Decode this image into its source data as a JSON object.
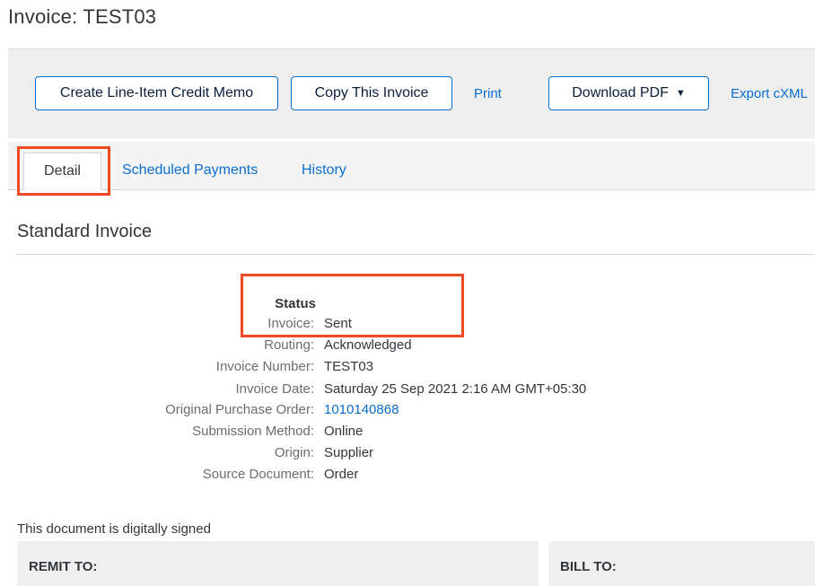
{
  "page": {
    "title": "Invoice: TEST03"
  },
  "toolbar": {
    "credit_memo_label": "Create Line-Item Credit Memo",
    "copy_invoice_label": "Copy This Invoice",
    "print_label": "Print",
    "download_pdf_label": "Download PDF",
    "download_caret": "▼",
    "export_cxml_label": "Export cXML"
  },
  "tabs": [
    {
      "label": "Detail",
      "active": true
    },
    {
      "label": "Scheduled Payments",
      "active": false
    },
    {
      "label": "History",
      "active": false
    }
  ],
  "section": {
    "title": "Standard Invoice"
  },
  "status": {
    "heading": "Status",
    "fields": [
      {
        "label": "Invoice:",
        "value": "Sent"
      },
      {
        "label": "Routing:",
        "value": "Acknowledged"
      },
      {
        "label": "Invoice Number:",
        "value": "TEST03"
      },
      {
        "label": "Invoice Date:",
        "value": "Saturday 25 Sep 2021 2:16 AM GMT+05:30"
      },
      {
        "label": "Original Purchase Order:",
        "value": "1010140868",
        "is_link": true
      },
      {
        "label": "Submission Method:",
        "value": "Online"
      },
      {
        "label": "Origin:",
        "value": "Supplier"
      },
      {
        "label": "Source Document:",
        "value": "Order"
      }
    ]
  },
  "footer": {
    "signed_note": "This document is digitally signed",
    "remit_to_label": "REMIT TO:",
    "bill_to_label": "BILL TO:"
  },
  "colors": {
    "link": "#0a6ed1",
    "highlight": "#f04a24",
    "toolbar_bg": "#eeeeee"
  }
}
